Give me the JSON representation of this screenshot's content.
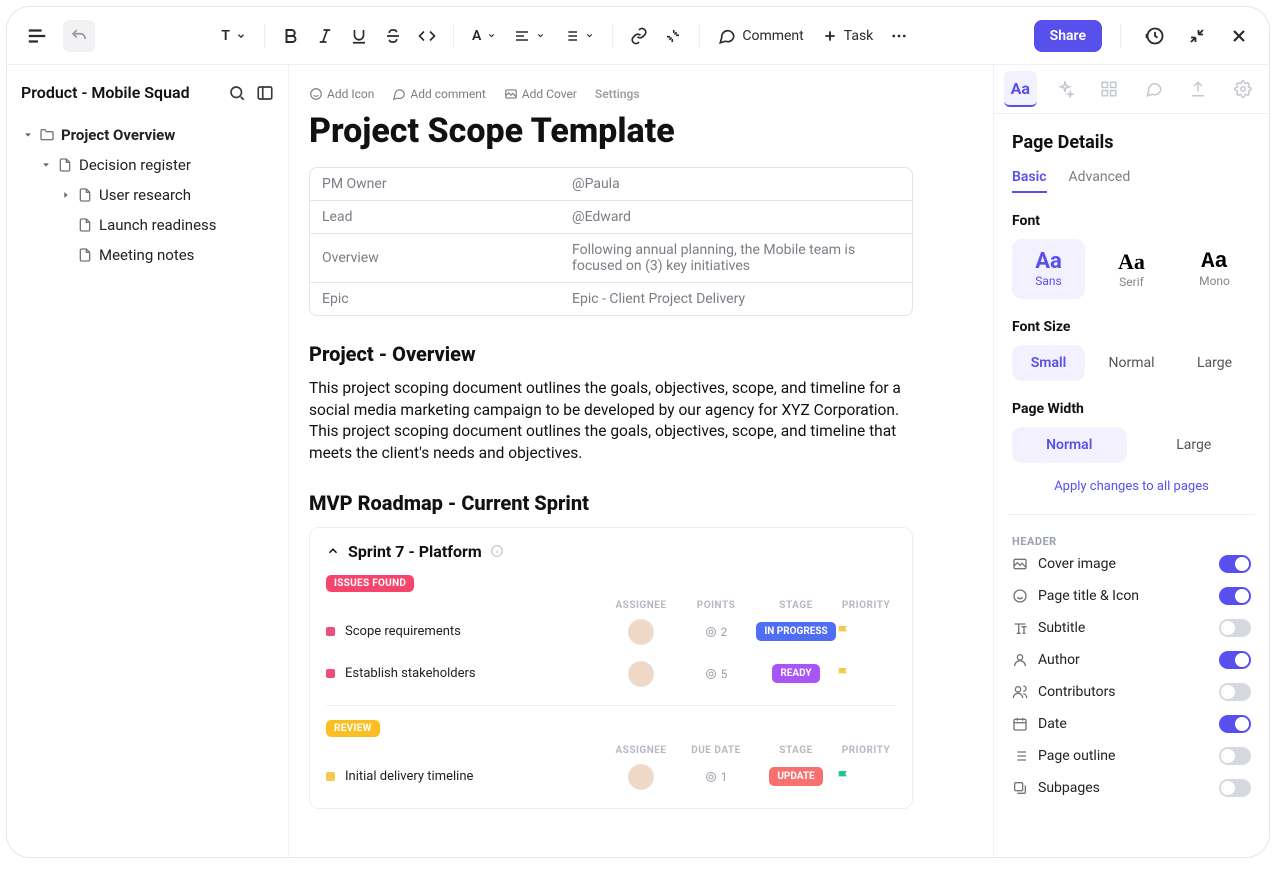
{
  "toolbar": {
    "text_style_label": "T",
    "comment_label": "Comment",
    "task_label": "Task",
    "share_label": "Share"
  },
  "sidebar": {
    "title": "Product - Mobile Squad",
    "tree": [
      {
        "label": "Project Overview",
        "bold": true
      },
      {
        "label": "Decision register"
      },
      {
        "label": "User research"
      },
      {
        "label": "Launch readiness"
      },
      {
        "label": "Meeting notes"
      }
    ]
  },
  "page_actions": {
    "add_icon": "Add Icon",
    "add_comment": "Add comment",
    "add_cover": "Add Cover",
    "settings": "Settings"
  },
  "document": {
    "title": "Project Scope Template",
    "info_table": [
      {
        "key": "PM Owner",
        "value": "@Paula"
      },
      {
        "key": "Lead",
        "value": "@Edward"
      },
      {
        "key": "Overview",
        "value": "Following annual planning, the Mobile team is focused on (3) key initiatives"
      },
      {
        "key": "Epic",
        "value": "Epic - Client Project Delivery"
      }
    ],
    "section1_title": "Project - Overview",
    "body1": "This project scoping document outlines the goals, objectives, scope, and timeline for a social media marketing campaign to be developed by our agency for XYZ Corporation. This project scoping document outlines the goals, objectives, scope, and timeline that meets the client's needs and objectives.",
    "section2_title": "MVP Roadmap - Current Sprint",
    "sprint": {
      "title": "Sprint  7 - Platform",
      "group1": {
        "status": "ISSUES FOUND",
        "columns": {
          "assignee": "ASSIGNEE",
          "points": "POINTS",
          "stage": "STAGE",
          "priority": "PRIORITY"
        },
        "rows": [
          {
            "name": "Scope requirements",
            "points": "2",
            "stage": "IN PROGRESS",
            "stage_class": "stage-progress",
            "flag": "#f3c94f"
          },
          {
            "name": "Establish stakeholders",
            "points": "5",
            "stage": "READY",
            "stage_class": "stage-ready",
            "flag": "#f3c94f"
          }
        ]
      },
      "group2": {
        "status": "REVIEW",
        "columns": {
          "assignee": "ASSIGNEE",
          "due": "DUE DATE",
          "stage": "STAGE",
          "priority": "PRIORITY"
        },
        "rows": [
          {
            "name": "Initial delivery timeline",
            "points": "1",
            "stage": "UPDATE",
            "stage_class": "stage-update",
            "flag": "#22c58b"
          }
        ]
      }
    }
  },
  "right_panel": {
    "title": "Page Details",
    "tabs": {
      "basic": "Basic",
      "advanced": "Advanced"
    },
    "font": {
      "label": "Font",
      "sample": "Aa",
      "sans": "Sans",
      "serif": "Serif",
      "mono": "Mono"
    },
    "font_size": {
      "label": "Font Size",
      "small": "Small",
      "normal": "Normal",
      "large": "Large"
    },
    "page_width": {
      "label": "Page Width",
      "normal": "Normal",
      "large": "Large"
    },
    "apply_all": "Apply changes to all pages",
    "header_label": "HEADER",
    "toggles": [
      {
        "label": "Cover image",
        "on": true,
        "icon": "image"
      },
      {
        "label": "Page title & Icon",
        "on": true,
        "icon": "smile"
      },
      {
        "label": "Subtitle",
        "on": false,
        "icon": "type"
      },
      {
        "label": "Author",
        "on": true,
        "icon": "user"
      },
      {
        "label": "Contributors",
        "on": false,
        "icon": "users"
      },
      {
        "label": "Date",
        "on": true,
        "icon": "calendar"
      },
      {
        "label": "Page outline",
        "on": false,
        "icon": "list"
      },
      {
        "label": "Subpages",
        "on": false,
        "icon": "stack"
      }
    ]
  }
}
